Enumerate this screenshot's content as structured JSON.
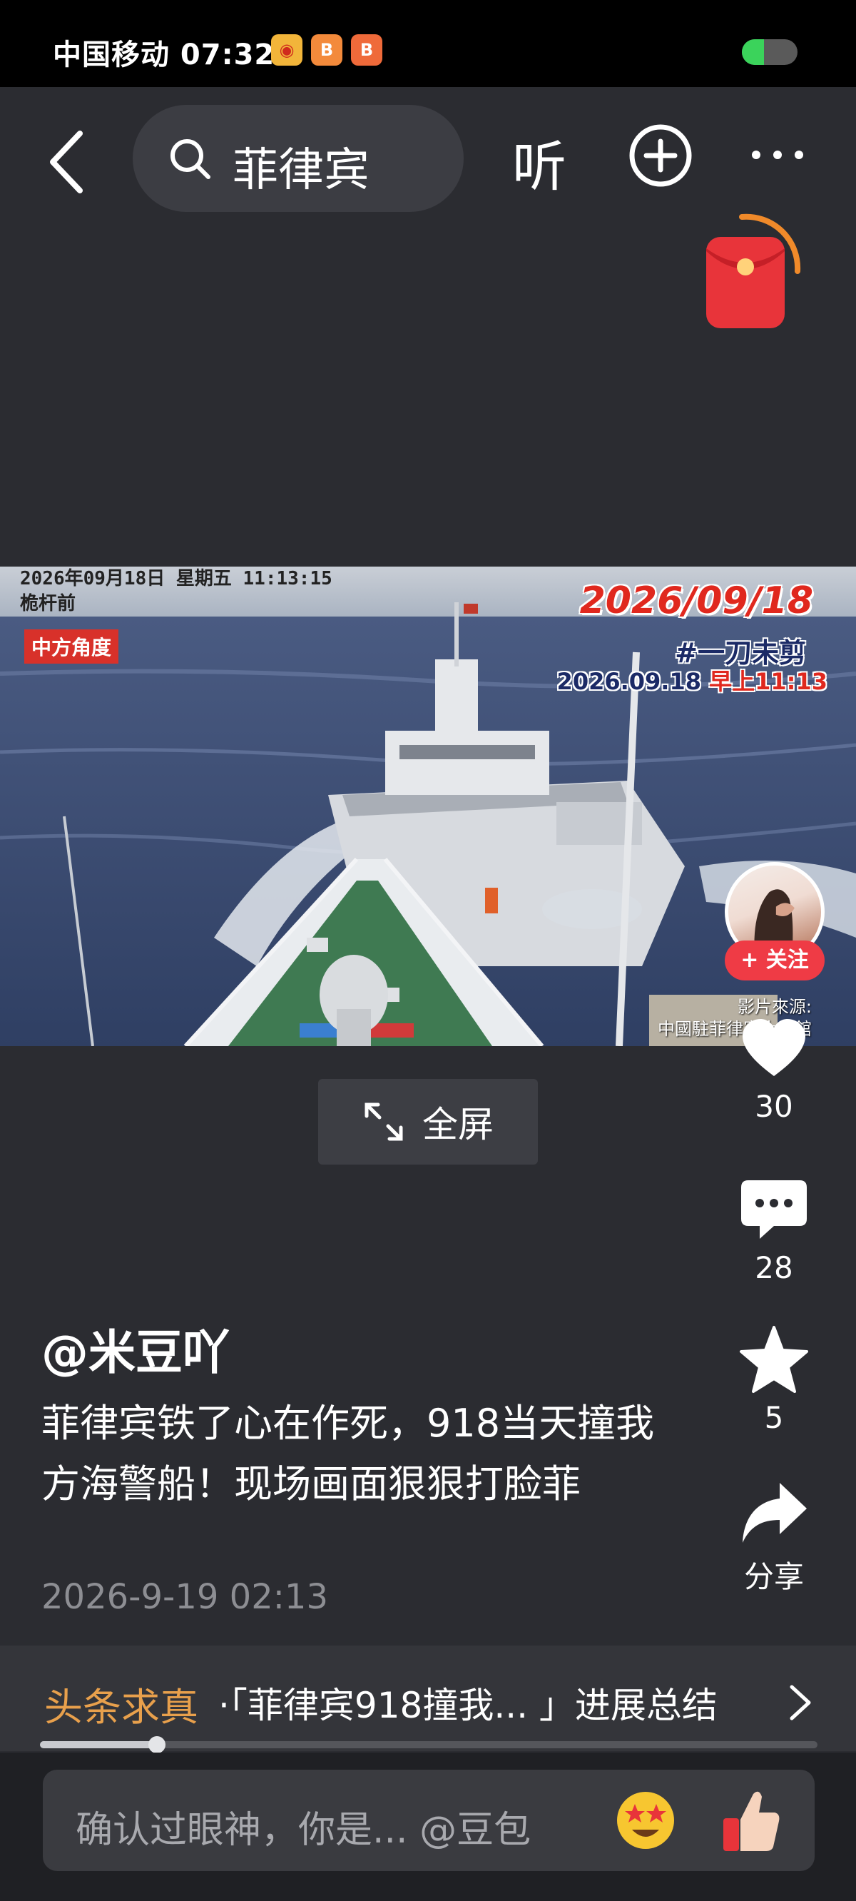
{
  "status_bar": {
    "carrier_time": "中国移动 07:32",
    "app_icons": [
      "weibo-icon",
      "app-icon",
      "app-icon"
    ],
    "battery_level": 0.4
  },
  "nav": {
    "search_text": "菲律宾",
    "listen_label": "听"
  },
  "video": {
    "timestamp_line1": "2026年09月18日  星期五  11:13:15",
    "timestamp_line2": "桅杆前",
    "tag": "中方角度",
    "date_title": "2026/09/18",
    "hashtag": "#一刀未剪",
    "time_prefix": "2026.09.18 ",
    "time_highlight": "早上11:13",
    "source_line1": "影片來源:",
    "source_line2": "中國駐菲律賓大使館"
  },
  "rail": {
    "follow_label": "+ 关注",
    "likes": "30",
    "comments": "28",
    "favorites": "5",
    "share_label": "分享"
  },
  "fullscreen_label": "全屏",
  "post": {
    "author": "@米豆吖",
    "text": "菲律宾铁了心在作死，918当天撞我方海警船！现场画面狠狠打脸菲",
    "time": "2026-9-19 02:13"
  },
  "fact_check": {
    "label": "头条求真",
    "text": "·「菲律宾918撞我... 」进展总结"
  },
  "playback_progress": 0.15,
  "comment": {
    "placeholder": "确认过眼神，你是... @豆包"
  },
  "colors": {
    "background": "#2b2c31",
    "accent_red": "#ef3b45",
    "fact_orange": "#e8a04c"
  }
}
